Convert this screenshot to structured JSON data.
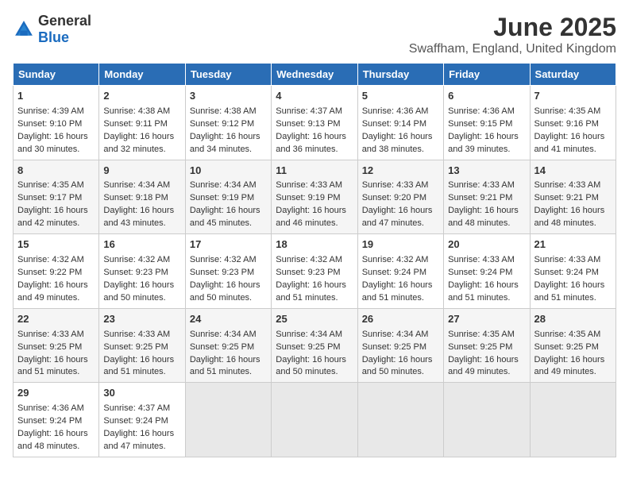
{
  "header": {
    "logo_general": "General",
    "logo_blue": "Blue",
    "title": "June 2025",
    "subtitle": "Swaffham, England, United Kingdom"
  },
  "days_of_week": [
    "Sunday",
    "Monday",
    "Tuesday",
    "Wednesday",
    "Thursday",
    "Friday",
    "Saturday"
  ],
  "weeks": [
    [
      {
        "day": 1,
        "lines": [
          "Sunrise: 4:39 AM",
          "Sunset: 9:10 PM",
          "Daylight: 16 hours",
          "and 30 minutes."
        ]
      },
      {
        "day": 2,
        "lines": [
          "Sunrise: 4:38 AM",
          "Sunset: 9:11 PM",
          "Daylight: 16 hours",
          "and 32 minutes."
        ]
      },
      {
        "day": 3,
        "lines": [
          "Sunrise: 4:38 AM",
          "Sunset: 9:12 PM",
          "Daylight: 16 hours",
          "and 34 minutes."
        ]
      },
      {
        "day": 4,
        "lines": [
          "Sunrise: 4:37 AM",
          "Sunset: 9:13 PM",
          "Daylight: 16 hours",
          "and 36 minutes."
        ]
      },
      {
        "day": 5,
        "lines": [
          "Sunrise: 4:36 AM",
          "Sunset: 9:14 PM",
          "Daylight: 16 hours",
          "and 38 minutes."
        ]
      },
      {
        "day": 6,
        "lines": [
          "Sunrise: 4:36 AM",
          "Sunset: 9:15 PM",
          "Daylight: 16 hours",
          "and 39 minutes."
        ]
      },
      {
        "day": 7,
        "lines": [
          "Sunrise: 4:35 AM",
          "Sunset: 9:16 PM",
          "Daylight: 16 hours",
          "and 41 minutes."
        ]
      }
    ],
    [
      {
        "day": 8,
        "lines": [
          "Sunrise: 4:35 AM",
          "Sunset: 9:17 PM",
          "Daylight: 16 hours",
          "and 42 minutes."
        ]
      },
      {
        "day": 9,
        "lines": [
          "Sunrise: 4:34 AM",
          "Sunset: 9:18 PM",
          "Daylight: 16 hours",
          "and 43 minutes."
        ]
      },
      {
        "day": 10,
        "lines": [
          "Sunrise: 4:34 AM",
          "Sunset: 9:19 PM",
          "Daylight: 16 hours",
          "and 45 minutes."
        ]
      },
      {
        "day": 11,
        "lines": [
          "Sunrise: 4:33 AM",
          "Sunset: 9:19 PM",
          "Daylight: 16 hours",
          "and 46 minutes."
        ]
      },
      {
        "day": 12,
        "lines": [
          "Sunrise: 4:33 AM",
          "Sunset: 9:20 PM",
          "Daylight: 16 hours",
          "and 47 minutes."
        ]
      },
      {
        "day": 13,
        "lines": [
          "Sunrise: 4:33 AM",
          "Sunset: 9:21 PM",
          "Daylight: 16 hours",
          "and 48 minutes."
        ]
      },
      {
        "day": 14,
        "lines": [
          "Sunrise: 4:33 AM",
          "Sunset: 9:21 PM",
          "Daylight: 16 hours",
          "and 48 minutes."
        ]
      }
    ],
    [
      {
        "day": 15,
        "lines": [
          "Sunrise: 4:32 AM",
          "Sunset: 9:22 PM",
          "Daylight: 16 hours",
          "and 49 minutes."
        ]
      },
      {
        "day": 16,
        "lines": [
          "Sunrise: 4:32 AM",
          "Sunset: 9:23 PM",
          "Daylight: 16 hours",
          "and 50 minutes."
        ]
      },
      {
        "day": 17,
        "lines": [
          "Sunrise: 4:32 AM",
          "Sunset: 9:23 PM",
          "Daylight: 16 hours",
          "and 50 minutes."
        ]
      },
      {
        "day": 18,
        "lines": [
          "Sunrise: 4:32 AM",
          "Sunset: 9:23 PM",
          "Daylight: 16 hours",
          "and 51 minutes."
        ]
      },
      {
        "day": 19,
        "lines": [
          "Sunrise: 4:32 AM",
          "Sunset: 9:24 PM",
          "Daylight: 16 hours",
          "and 51 minutes."
        ]
      },
      {
        "day": 20,
        "lines": [
          "Sunrise: 4:33 AM",
          "Sunset: 9:24 PM",
          "Daylight: 16 hours",
          "and 51 minutes."
        ]
      },
      {
        "day": 21,
        "lines": [
          "Sunrise: 4:33 AM",
          "Sunset: 9:24 PM",
          "Daylight: 16 hours",
          "and 51 minutes."
        ]
      }
    ],
    [
      {
        "day": 22,
        "lines": [
          "Sunrise: 4:33 AM",
          "Sunset: 9:25 PM",
          "Daylight: 16 hours",
          "and 51 minutes."
        ]
      },
      {
        "day": 23,
        "lines": [
          "Sunrise: 4:33 AM",
          "Sunset: 9:25 PM",
          "Daylight: 16 hours",
          "and 51 minutes."
        ]
      },
      {
        "day": 24,
        "lines": [
          "Sunrise: 4:34 AM",
          "Sunset: 9:25 PM",
          "Daylight: 16 hours",
          "and 51 minutes."
        ]
      },
      {
        "day": 25,
        "lines": [
          "Sunrise: 4:34 AM",
          "Sunset: 9:25 PM",
          "Daylight: 16 hours",
          "and 50 minutes."
        ]
      },
      {
        "day": 26,
        "lines": [
          "Sunrise: 4:34 AM",
          "Sunset: 9:25 PM",
          "Daylight: 16 hours",
          "and 50 minutes."
        ]
      },
      {
        "day": 27,
        "lines": [
          "Sunrise: 4:35 AM",
          "Sunset: 9:25 PM",
          "Daylight: 16 hours",
          "and 49 minutes."
        ]
      },
      {
        "day": 28,
        "lines": [
          "Sunrise: 4:35 AM",
          "Sunset: 9:25 PM",
          "Daylight: 16 hours",
          "and 49 minutes."
        ]
      }
    ],
    [
      {
        "day": 29,
        "lines": [
          "Sunrise: 4:36 AM",
          "Sunset: 9:24 PM",
          "Daylight: 16 hours",
          "and 48 minutes."
        ]
      },
      {
        "day": 30,
        "lines": [
          "Sunrise: 4:37 AM",
          "Sunset: 9:24 PM",
          "Daylight: 16 hours",
          "and 47 minutes."
        ]
      },
      null,
      null,
      null,
      null,
      null
    ]
  ]
}
